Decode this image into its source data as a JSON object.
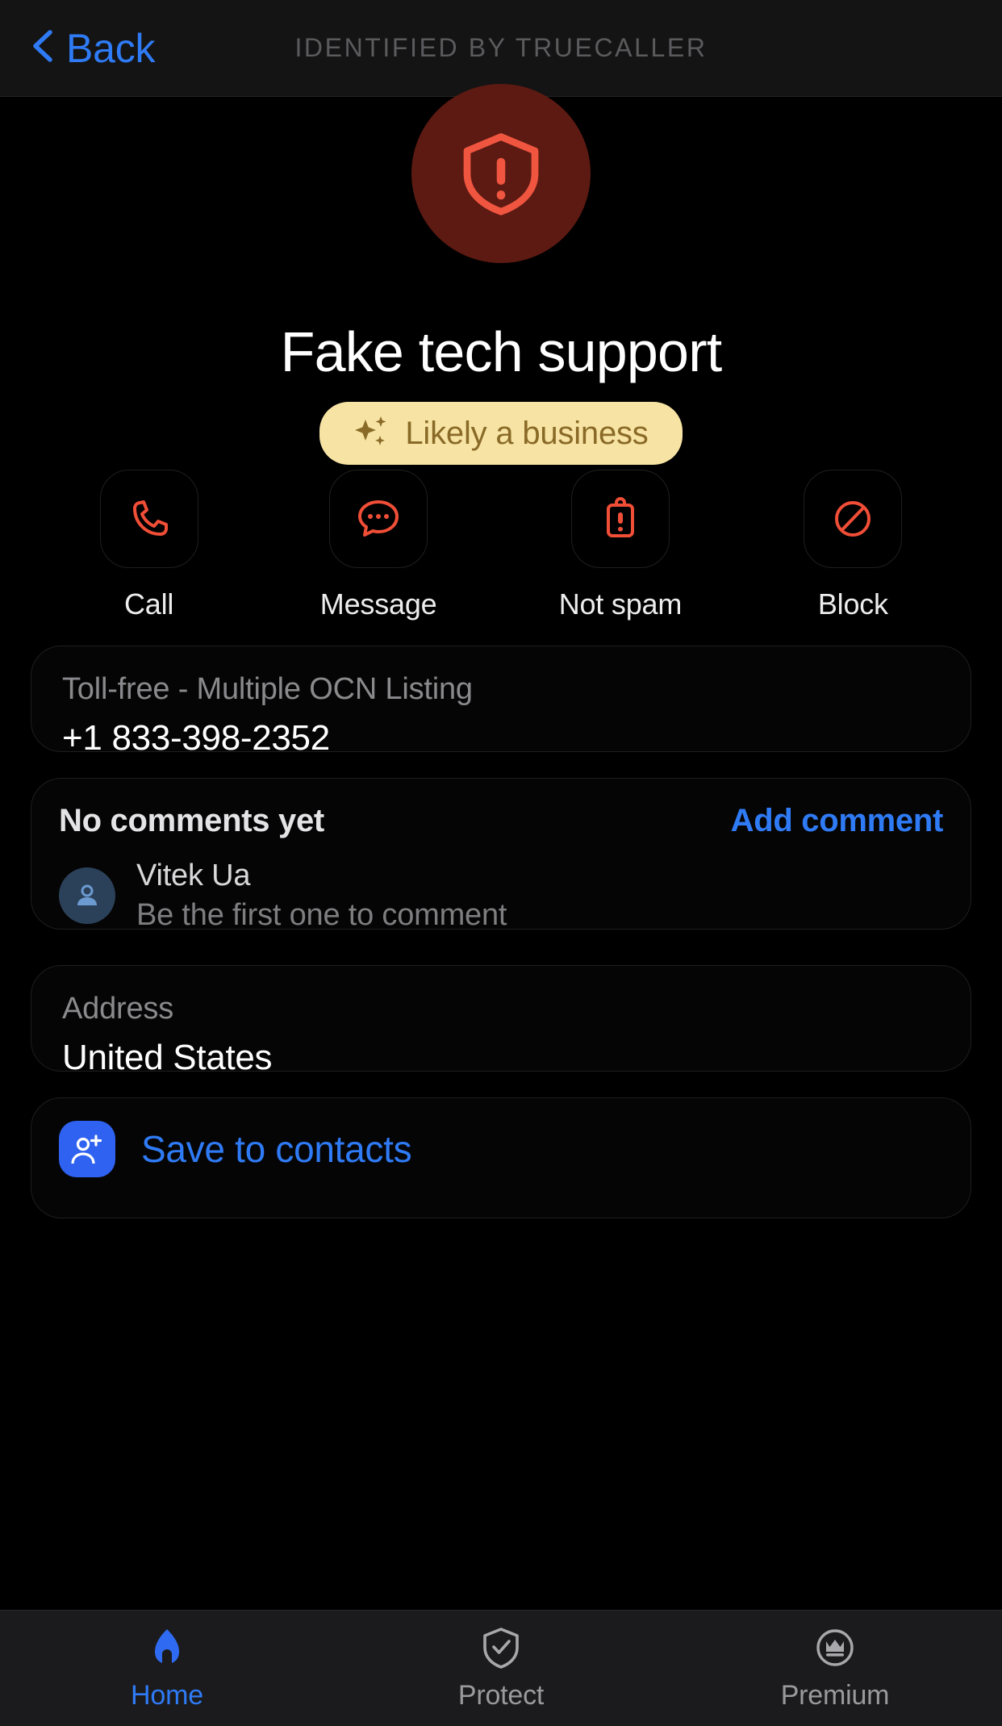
{
  "header": {
    "back_label": "Back",
    "title": "IDENTIFIED BY TRUECALLER",
    "back_color": "#2F7BF6",
    "title_color": "#5B5B5E"
  },
  "profile": {
    "name": "Fake tech support",
    "avatar_icon": "shield-warning-icon",
    "avatar_bg": "#5C1A12",
    "avatar_icon_color": "#F05540",
    "badge": {
      "label": "Likely a business",
      "icon": "ai-sparkle-icon",
      "bg": "#F7E4A5",
      "text_color": "#8A6A27"
    }
  },
  "actions": [
    {
      "label": "Call",
      "icon": "phone-icon",
      "color": "#F04E37"
    },
    {
      "label": "Message",
      "icon": "chat-bubble-icon",
      "color": "#F04E37"
    },
    {
      "label": "Not spam",
      "icon": "report-clipboard-icon",
      "color": "#F04E37"
    },
    {
      "label": "Block",
      "icon": "block-circle-icon",
      "color": "#F04E37"
    }
  ],
  "number_card": {
    "label": "Toll-free - Multiple OCN Listing",
    "value": "+1 833-398-2352"
  },
  "comments_card": {
    "title": "No comments yet",
    "add_label": "Add comment",
    "user_name": "Vitek  Ua",
    "user_subtitle": "Be the first one to comment",
    "avatar_bg": "#2B4159",
    "avatar_icon": "person-icon"
  },
  "address_card": {
    "label": "Address",
    "value": "United States"
  },
  "save_card": {
    "label": "Save to contacts",
    "icon": "person-add-icon",
    "icon_bg": "#2F62F0",
    "text_color": "#2F7BF6"
  },
  "bottom_nav": [
    {
      "label": "Home",
      "icon": "home-icon",
      "active": true
    },
    {
      "label": "Protect",
      "icon": "shield-check-icon",
      "active": false
    },
    {
      "label": "Premium",
      "icon": "crown-circle-icon",
      "active": false
    }
  ]
}
